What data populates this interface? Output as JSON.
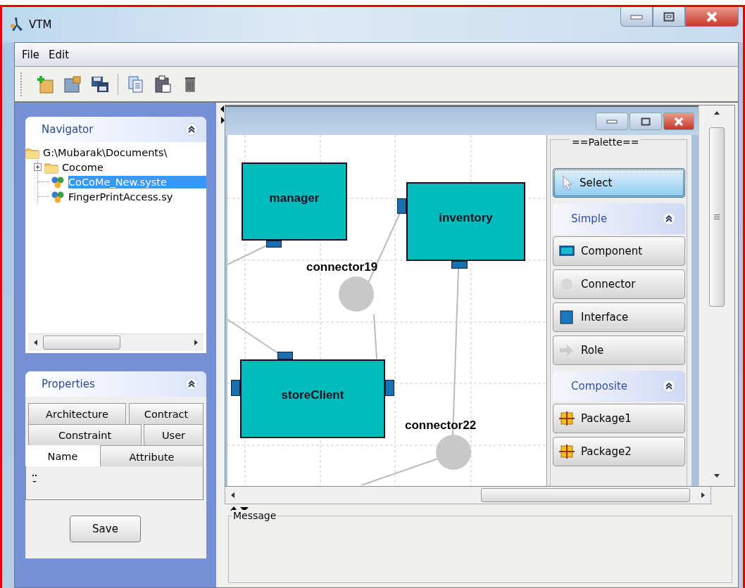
{
  "window": {
    "title": "VTM"
  },
  "menu": [
    {
      "label": "File"
    },
    {
      "label": "Edit"
    }
  ],
  "toolbar": [
    {
      "kind": "new"
    },
    {
      "kind": "open"
    },
    {
      "kind": "save"
    },
    {
      "kind": "separator"
    },
    {
      "kind": "copy"
    },
    {
      "kind": "paste"
    },
    {
      "kind": "delete"
    }
  ],
  "navigator": {
    "title": "Navigator",
    "expanded": true,
    "tree": [
      {
        "label": "G:\\Mubarak\\Documents\\",
        "kind": "folder",
        "selected": false,
        "children": [
          {
            "label": "Cocome",
            "kind": "folder",
            "expanded": false,
            "selected": false
          },
          {
            "label": "CoCoMe_New.syste",
            "kind": "system",
            "selected": true
          },
          {
            "label": "FingerPrintAccess.sy",
            "kind": "system",
            "selected": false
          }
        ]
      }
    ]
  },
  "properties": {
    "title": "Properties",
    "expanded": true,
    "tab_rows": [
      [
        {
          "label": "Architecture",
          "selected": false
        },
        {
          "label": "Contract",
          "selected": false
        }
      ],
      [
        {
          "label": "Constraint",
          "selected": false
        },
        {
          "label": "User",
          "selected": false
        }
      ],
      [
        {
          "label": "Name",
          "selected": true
        },
        {
          "label": "Attribute",
          "selected": false
        }
      ]
    ],
    "save_button": "Save"
  },
  "diagram": {
    "components": [
      {
        "name": "manager"
      },
      {
        "name": "inventory"
      },
      {
        "name": "storeClient"
      }
    ],
    "connectors": [
      {
        "name": "connector19"
      },
      {
        "name": "connector22"
      }
    ]
  },
  "palette": {
    "title": "==Palette==",
    "select": {
      "label": "Select",
      "selected": true
    },
    "groups": [
      {
        "title": "Simple",
        "expanded": true,
        "tools": [
          {
            "label": "Component",
            "kind": "component"
          },
          {
            "label": "Connector",
            "kind": "connector"
          },
          {
            "label": "Interface",
            "kind": "interface"
          },
          {
            "label": "Role",
            "kind": "role"
          }
        ]
      },
      {
        "title": "Composite",
        "expanded": true,
        "tools": [
          {
            "label": "Package1",
            "kind": "package"
          },
          {
            "label": "Package2",
            "kind": "package"
          }
        ]
      }
    ]
  },
  "message": {
    "title": "Message"
  }
}
